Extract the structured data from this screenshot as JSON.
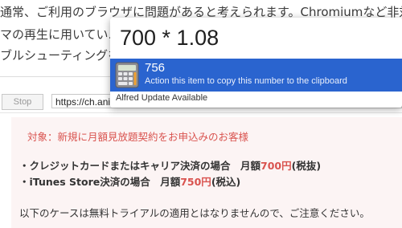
{
  "background": {
    "line1": "通常、ご利用のブラウザに問題があると考えられます。Chromiumなど非対",
    "line2": "マの再生に用いてい…",
    "line3": "ブルシューティングを…"
  },
  "toolbar": {
    "stop_label": "Stop",
    "url": "https://ch.ani.t"
  },
  "notice": {
    "title": "対象：新規に月額見放題契約をお申込みのお客様",
    "line1_prefix": "・クレジットカードまたはキャリア決済の場合　月額",
    "line1_price": "700円",
    "line1_suffix": "(税抜)",
    "line2_prefix": "・iTunes Store決済の場合　月額",
    "line2_price": "750円",
    "line2_suffix": "(税込)",
    "line3": "以下のケースは無料トライアルの適用とはなりませんので、ご注意ください。"
  },
  "alfred": {
    "query": "700 * 1.08",
    "result_value": "756",
    "result_action": "Action this item to copy this number to the clipboard",
    "result_icon": "calculator-icon",
    "update_label": "Alfred Update Available",
    "accent_color": "#2a64cf"
  }
}
